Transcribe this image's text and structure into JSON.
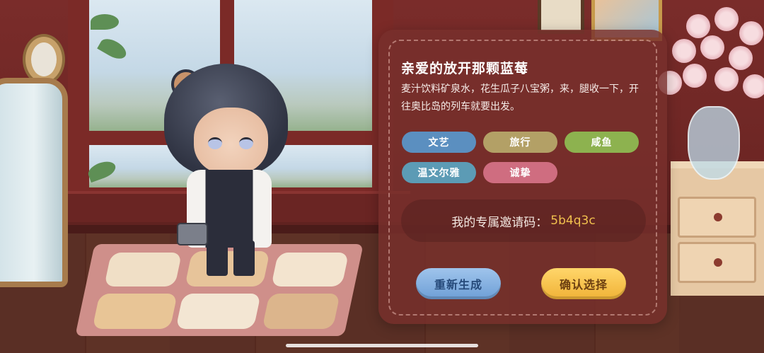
{
  "profile": {
    "nickname": "亲爱的放开那颗蓝莓",
    "signature": "麦汁饮料矿泉水，花生瓜子八宝粥，来，腿收一下，开往奥比岛的列车就要出发。",
    "tags": [
      {
        "label": "文艺",
        "color": "#5b8fc0"
      },
      {
        "label": "旅行",
        "color": "#b3a066"
      },
      {
        "label": "咸鱼",
        "color": "#8db24f"
      },
      {
        "label": "温文尔雅",
        "color": "#5c9bb5"
      },
      {
        "label": "诚挚",
        "color": "#cf6d80"
      }
    ],
    "invite_label": "我的专属邀请码：",
    "invite_code": "5b4q3c"
  },
  "buttons": {
    "regenerate": "重新生成",
    "confirm": "确认选择"
  }
}
